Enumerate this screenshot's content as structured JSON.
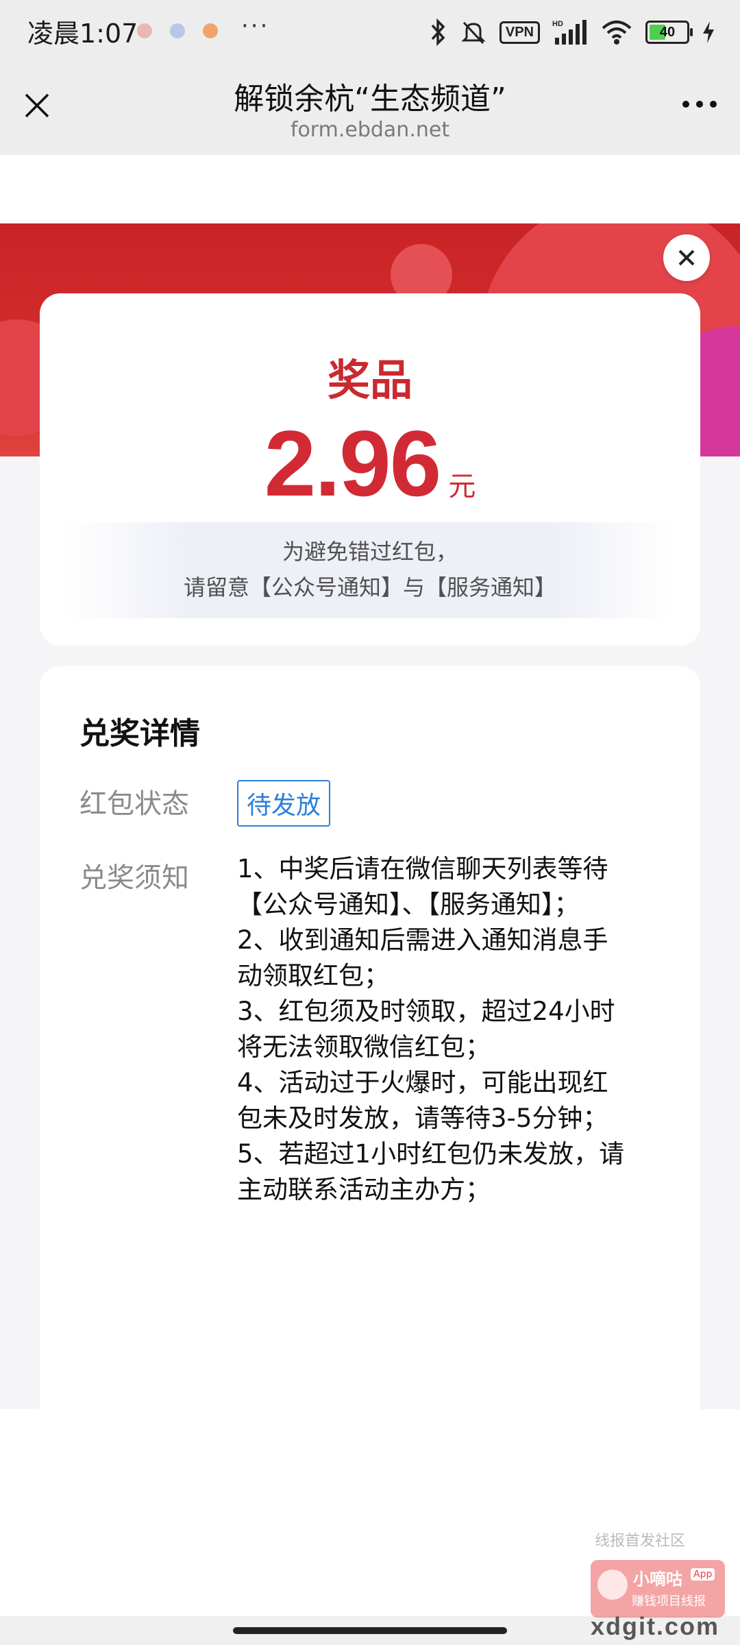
{
  "status_bar": {
    "time": "凌晨1:07",
    "dots": "···",
    "vpn": "VPN",
    "battery": "40",
    "hd": "HD"
  },
  "nav": {
    "title": "解锁余杭“生态频道”",
    "subtitle": "form.ebdan.net",
    "close_icon": "close-icon",
    "more_icon": "more-icon"
  },
  "prize": {
    "label": "奖品",
    "amount": "2.96",
    "unit": "元",
    "notice_line1": "为避免错过红包，",
    "notice_line2": "请留意【公众号通知】与【服务通知】"
  },
  "detail": {
    "title": "兑奖详情",
    "status_label": "红包状态",
    "status_value": "待发放",
    "rules_label": "兑奖须知",
    "rules": [
      "1、中奖后请在微信聊天列表等待",
      "【公众号通知】、【服务通知】；",
      "2、收到通知后需进入通知消息手",
      "动领取红包；",
      "3、红包须及时领取，超过24小时",
      "将无法领取微信红包；",
      "4、活动过于火爆时，可能出现红",
      "包未及时发放，请等待3-5分钟；",
      "5、若超过1小时红包仍未发放，请",
      "主动联系活动主办方；"
    ]
  },
  "watermark": {
    "top_text": "线报首发社区",
    "badge_name": "小嘀咕",
    "badge_app": "App",
    "badge_sub": "赚钱项目线报",
    "domain": "xdgit.com"
  },
  "colors": {
    "accent_red": "#d22a34",
    "tag_blue": "#2d7fd6",
    "banner_red": "#c92326"
  }
}
